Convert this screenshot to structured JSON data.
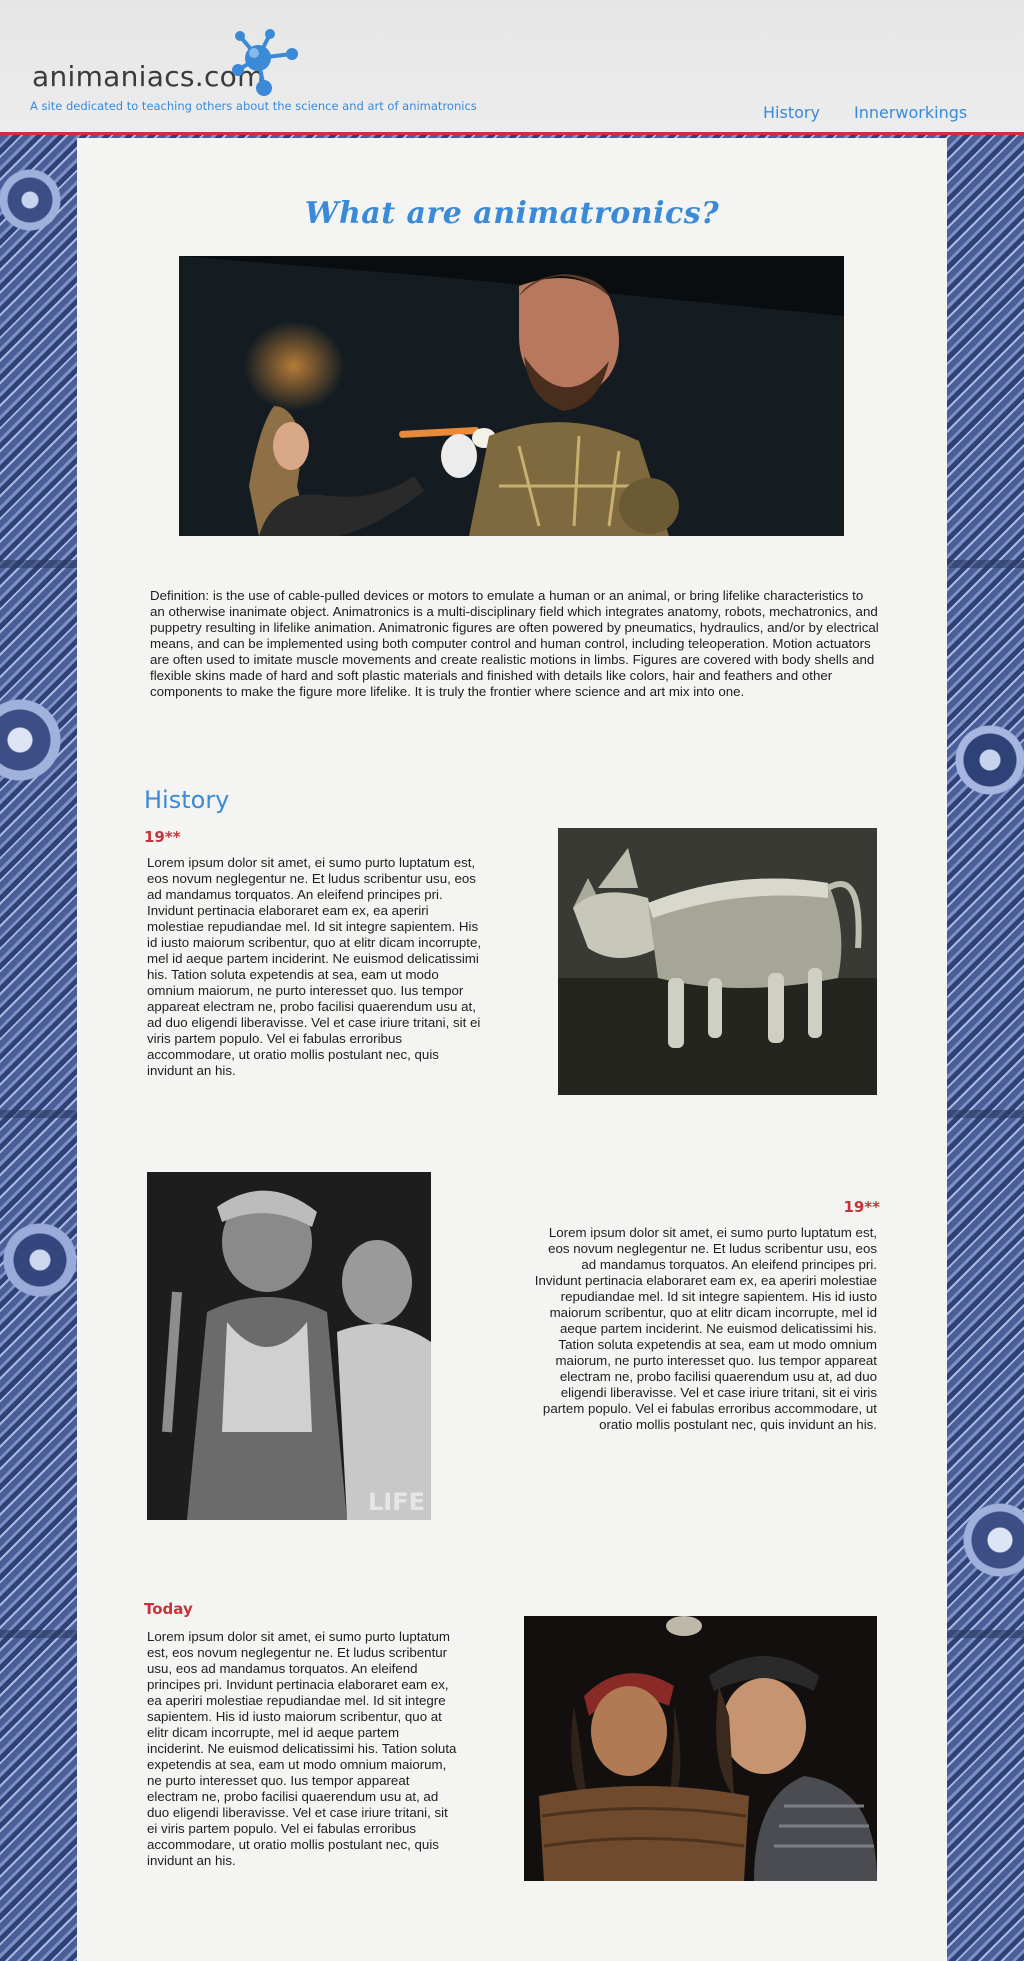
{
  "site": {
    "name": "animaniacs.com",
    "tagline": "A site dedicated to teaching others about the science and art of animatronics"
  },
  "nav": {
    "items": [
      {
        "label": "History"
      },
      {
        "label": "Innerworkings"
      }
    ]
  },
  "main": {
    "title": "What are animatronics?",
    "definition": "Definition: is the use of cable-pulled devices or motors to emulate a human or an animal, or bring lifelike characteristics to an otherwise inanimate object. Animatronics is a multi-disciplinary field which integrates anatomy, robots, mechatronics, and puppetry resulting in lifelike animation. Animatronic figures are often powered by pneumatics, hydraulics, and/or by electrical means, and can be implemented using both computer control and human control, including teleoperation. Motion actuators are often used to imitate muscle movements and create realistic motions in limbs. Figures are covered with body shells and flexible skins made of hard and soft plastic materials and finished with details like colors, hair and feathers and other components to make the figure more lifelike. It is truly the frontier where science and art mix into one."
  },
  "history": {
    "heading": "History",
    "sections": [
      {
        "era": "19**",
        "text": "Lorem ipsum dolor sit amet, ei sumo purto luptatum est, eos novum neglegentur ne. Et ludus scribentur usu, eos ad mandamus torquatos. An eleifend principes pri. Invidunt pertinacia elaboraret eam ex, ea aperiri molestiae repudiandae mel. Id sit integre sapientem. His id iusto maiorum scribentur, quo at elitr dicam incorrupte, mel id aeque partem inciderint. Ne euismod delicatissimi his. Tation soluta expetendis at sea, eam ut modo omnium maiorum, ne purto interesset quo. Ius tempor appareat electram ne, probo facilisi quaerendum usu at, ad duo eligendi liberavisse. Vel et case iriure tritani, sit ei viris partem populo. Vel ei fabulas erroribus accommodare, ut oratio mollis postulant nec, quis invidunt an his."
      },
      {
        "era": "19**",
        "text": "Lorem ipsum dolor sit amet, ei sumo purto luptatum est, eos novum neglegentur ne. Et ludus scribentur usu, eos ad mandamus torquatos. An eleifend principes pri. Invidunt pertinacia elaboraret eam ex, ea aperiri molestiae repudiandae mel. Id sit integre sapientem. His id iusto maiorum scribentur, quo at elitr dicam incorrupte, mel id aeque partem inciderint. Ne euismod delicatissimi his. Tation soluta expetendis at sea, eam ut modo omnium maiorum, ne purto interesset quo. Ius tempor appareat electram ne, probo facilisi quaerendum usu at, ad duo eligendi liberavisse. Vel et case iriure tritani, sit ei viris partem populo. Vel ei fabulas erroribus accommodare, ut oratio mollis postulant nec, quis invidunt an his."
      },
      {
        "era": "Today",
        "text": "Lorem ipsum dolor sit amet, ei sumo purto luptatum est, eos novum neglegentur ne. Et ludus scribentur usu, eos ad mandamus torquatos. An eleifend principes pri. Invidunt pertinacia elaboraret eam ex, ea aperiri molestiae repudiandae mel. Id sit integre sapientem. His id iusto maiorum scribentur, quo at elitr dicam incorrupte, mel id aeque partem inciderint. Ne euismod delicatissimi his. Tation soluta expetendis at sea, eam ut modo omnium maiorum, ne purto interesset quo. Ius tempor appareat electram ne, probo facilisi quaerendum usu at, ad duo eligendi liberavisse. Vel et case iriure tritani, sit ei viris partem populo. Vel ei fabulas erroribus accommodare, ut oratio mollis postulant nec, quis invidunt an his."
      }
    ],
    "watermark": "LIFE"
  },
  "colors": {
    "accent": "#3a8ad8",
    "era": "#c8333a",
    "header_rule": "#c8333a",
    "panel": "#f4f4f2"
  }
}
